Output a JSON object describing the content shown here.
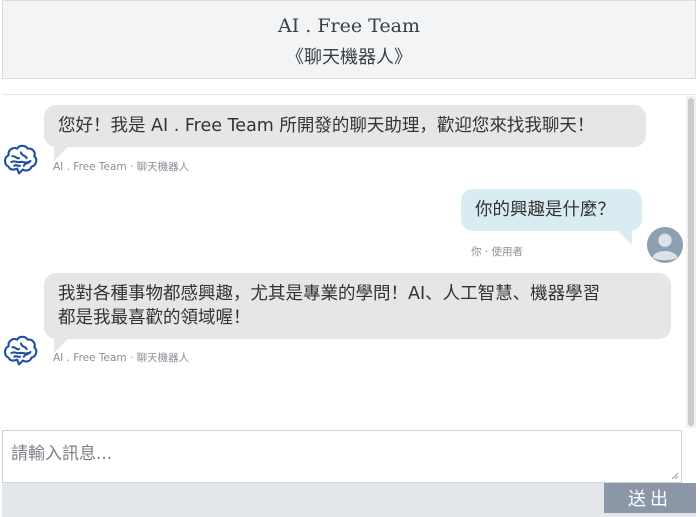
{
  "header": {
    "title": "AI . Free Team",
    "subtitle": "《聊天機器人》"
  },
  "messages": [
    {
      "role": "bot",
      "text_lines": [
        "您好！我是 AI . Free Team 所開發的聊天助理，歡迎您來找我聊天！"
      ],
      "meta": "AI . Free Team · 聊天機器人",
      "avatar_icon": "brain-icon"
    },
    {
      "role": "user",
      "text_lines": [
        "你的興趣是什麼？"
      ],
      "meta": "你 · 使用者",
      "avatar_icon": "user-avatar-icon"
    },
    {
      "role": "bot",
      "text_lines": [
        "我對各種事物都感興趣，尤其是專業的學問！AI、人工智慧、機器學習",
        "都是我最喜歡的領域喔！"
      ],
      "meta": "AI . Free Team · 聊天機器人",
      "avatar_icon": "brain-icon"
    }
  ],
  "input": {
    "placeholder": "請輸入訊息...",
    "value": ""
  },
  "send_label": "送出",
  "colors": {
    "bot_bubble": "#e6e6e6",
    "user_bubble": "#d9ecf1",
    "brain_icon": "#1e4fa3",
    "send_button": "#8b97a6",
    "header_bg": "#f3f4f6"
  }
}
